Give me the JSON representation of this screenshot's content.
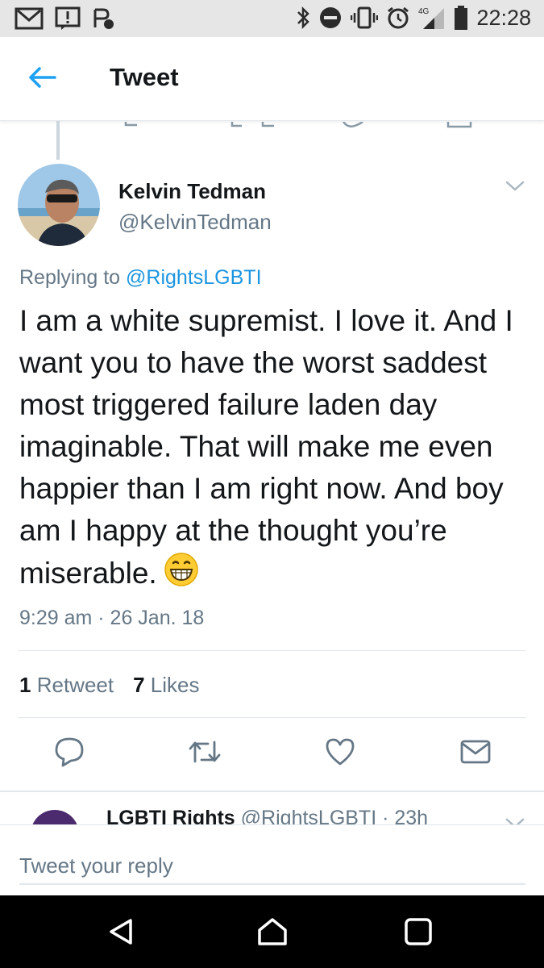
{
  "status_bar": {
    "time": "22:28",
    "network": "4G",
    "icons": [
      "gmail-icon",
      "alert-icon",
      "app-icon",
      "bluetooth-icon",
      "do-not-disturb-icon",
      "vibrate-icon",
      "alarm-icon",
      "signal-icon",
      "battery-icon"
    ]
  },
  "header": {
    "title": "Tweet"
  },
  "tweet": {
    "author_name": "Kelvin Tedman",
    "author_handle": "@KelvinTedman",
    "replying_prefix": "Replying to",
    "replying_to": "@RightsLGBTI",
    "text": "I am a white supremist. I love it. And I want you to have the worst saddest most triggered failure laden day imaginable. That will make me even happier than I am right now. And boy am I happy at the thought you’re miserable.",
    "emoji": "grinning-face-icon",
    "timestamp": "9:29 am · 26 Jan. 18",
    "retweet_count": "1",
    "retweet_label": "Retweet",
    "like_count": "7",
    "like_label": "Likes"
  },
  "next_tweet": {
    "author_name": "LGBTI Rights",
    "author_handle": "@RightsLGBTI · 23h"
  },
  "composer": {
    "placeholder": "Tweet your reply"
  },
  "colors": {
    "accent": "#1da1f2",
    "link": "#1b95e0",
    "secondary_text": "#657786",
    "nav_bar": "#000000"
  }
}
